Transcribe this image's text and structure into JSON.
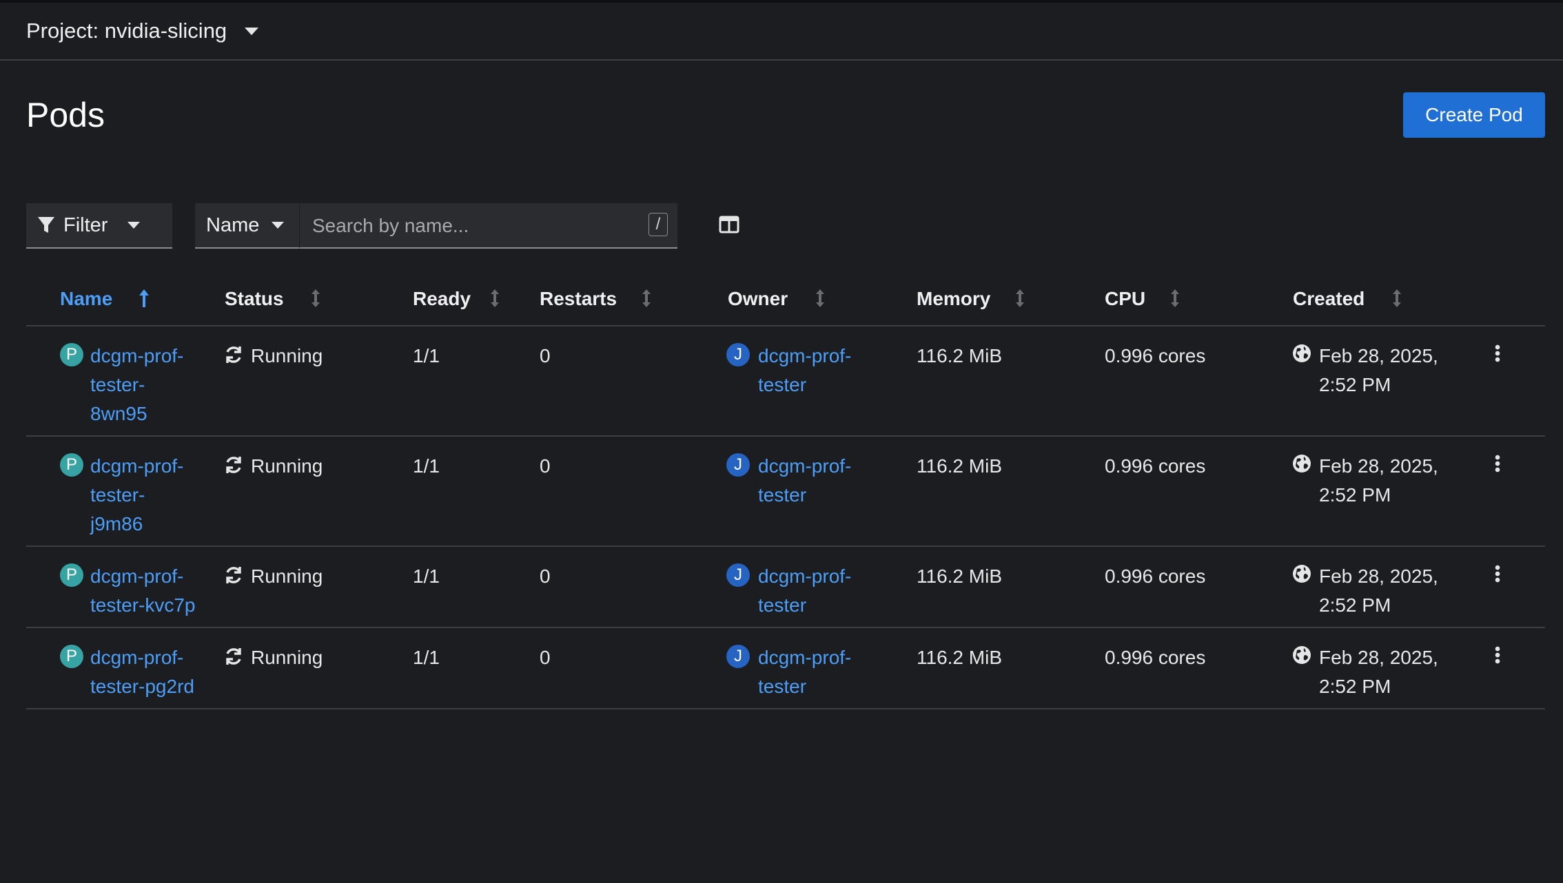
{
  "project": {
    "label": "Project: nvidia-slicing"
  },
  "page": {
    "title": "Pods",
    "create_button": "Create Pod"
  },
  "toolbar": {
    "filter_label": "Filter",
    "name_select": "Name",
    "search_placeholder": "Search by name...",
    "slash_hint": "/"
  },
  "columns": [
    "Name",
    "Status",
    "Ready",
    "Restarts",
    "Owner",
    "Memory",
    "CPU",
    "Created"
  ],
  "rows": [
    {
      "badge": "P",
      "name_lines": [
        "dcgm-prof-",
        "tester-",
        "8wn95"
      ],
      "status": "Running",
      "ready": "1/1",
      "restarts": "0",
      "owner_badge": "J",
      "owner_lines": [
        "dcgm-prof-",
        "tester"
      ],
      "memory": "116.2 MiB",
      "cpu": "0.996 cores",
      "created_lines": [
        "Feb 28, 2025,",
        "2:52 PM"
      ]
    },
    {
      "badge": "P",
      "name_lines": [
        "dcgm-prof-",
        "tester-",
        "j9m86"
      ],
      "status": "Running",
      "ready": "1/1",
      "restarts": "0",
      "owner_badge": "J",
      "owner_lines": [
        "dcgm-prof-",
        "tester"
      ],
      "memory": "116.2 MiB",
      "cpu": "0.996 cores",
      "created_lines": [
        "Feb 28, 2025,",
        "2:52 PM"
      ]
    },
    {
      "badge": "P",
      "name_lines": [
        "dcgm-prof-",
        "tester-kvc7p"
      ],
      "status": "Running",
      "ready": "1/1",
      "restarts": "0",
      "owner_badge": "J",
      "owner_lines": [
        "dcgm-prof-",
        "tester"
      ],
      "memory": "116.2 MiB",
      "cpu": "0.996 cores",
      "created_lines": [
        "Feb 28, 2025,",
        "2:52 PM"
      ]
    },
    {
      "badge": "P",
      "name_lines": [
        "dcgm-prof-",
        "tester-pg2rd"
      ],
      "status": "Running",
      "ready": "1/1",
      "restarts": "0",
      "owner_badge": "J",
      "owner_lines": [
        "dcgm-prof-",
        "tester"
      ],
      "memory": "116.2 MiB",
      "cpu": "0.996 cores",
      "created_lines": [
        "Feb 28, 2025,",
        "2:52 PM"
      ]
    }
  ],
  "colors": {
    "accent": "#1f6fd4",
    "link": "#4d9ef7",
    "pod_badge": "#37a3a3",
    "owner_badge": "#2564c3",
    "background": "#1b1d21"
  }
}
